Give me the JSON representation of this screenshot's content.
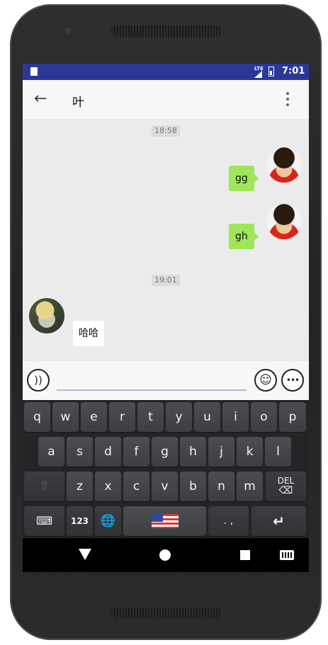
{
  "status_bar": {
    "network": "LTE",
    "time": "7:01"
  },
  "app_bar": {
    "back_icon": "arrow-left-icon",
    "title": "叶",
    "menu_icon": "more-vert-icon"
  },
  "messages": [
    {
      "type": "timestamp",
      "text": "18:58"
    },
    {
      "type": "outgoing",
      "text": "gg",
      "avatar": "luffy-avatar"
    },
    {
      "type": "outgoing",
      "text": "gh",
      "avatar": "luffy-avatar"
    },
    {
      "type": "timestamp",
      "text": "19:01"
    },
    {
      "type": "incoming",
      "text": "哈哈",
      "avatar": "contact-avatar"
    }
  ],
  "input_bar": {
    "voice_icon": "voice-icon",
    "input_value": "",
    "emoji_icon": "emoji-icon",
    "more_icon": "more-options-icon"
  },
  "keyboard": {
    "row1": [
      "q",
      "w",
      "e",
      "r",
      "t",
      "y",
      "u",
      "i",
      "o",
      "p"
    ],
    "row2": [
      "a",
      "s",
      "d",
      "f",
      "g",
      "h",
      "j",
      "k",
      "l"
    ],
    "row3": [
      "z",
      "x",
      "c",
      "v",
      "b",
      "n",
      "m"
    ],
    "del_label": "DEL",
    "numbers_label": "123",
    "punct_label": ". ,"
  },
  "colors": {
    "status_bar": "#2b3897",
    "bubble_out": "#9fe658",
    "input_underline": "#b9b0e8"
  }
}
